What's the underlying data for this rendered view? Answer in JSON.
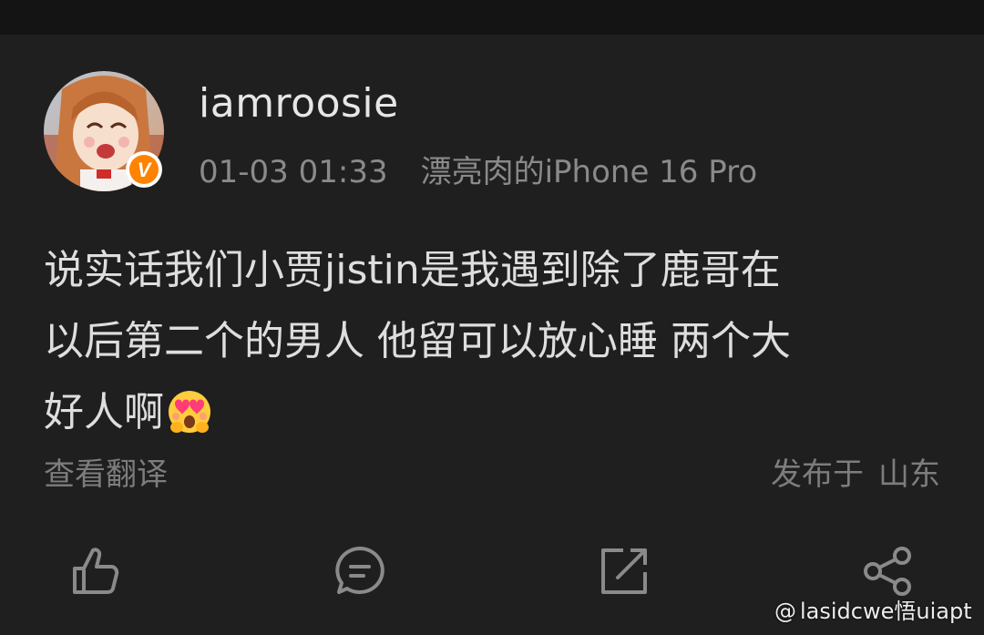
{
  "post": {
    "username": "iamroosie",
    "timestamp": "01-03 01:33",
    "device": "漂亮肉的iPhone 16 Pro",
    "verified_badge": "V",
    "body_lines": [
      "说实话我们小贾jistin是我遇到除了鹿哥在",
      "以后第二个的男人 他留可以放心睡 两个大",
      "好人啊"
    ],
    "emoji": "smiling-face-with-heart-eyes-icon",
    "translate_label": "查看翻译",
    "location_prefix": "发布于",
    "location_place": "山东"
  },
  "actions": [
    "like-icon",
    "comment-icon",
    "repost-icon",
    "share-icon"
  ],
  "watermark": {
    "at": "@",
    "text": "lasidcwe悟uiapt"
  },
  "colors": {
    "background": "#1f1f1f",
    "badge": "#ff8200",
    "text_primary": "#e6e6e6",
    "text_secondary": "#8a8a8a"
  }
}
